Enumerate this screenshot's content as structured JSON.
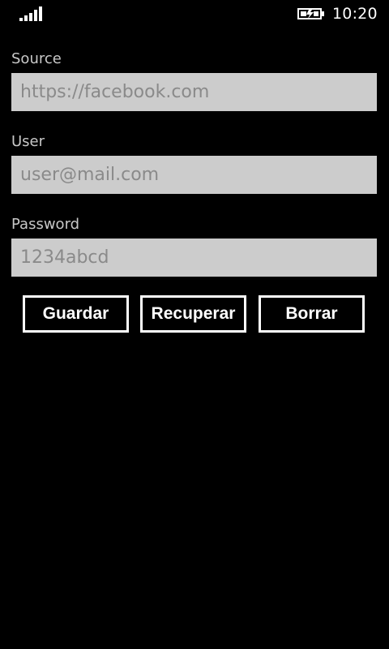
{
  "status_bar": {
    "time": "10:20",
    "signal_icon": "signal-strength-icon",
    "battery_icon": "battery-charging-icon"
  },
  "form": {
    "source": {
      "label": "Source",
      "placeholder": "https://facebook.com"
    },
    "user": {
      "label": "User",
      "placeholder": "user@mail.com"
    },
    "password": {
      "label": "Password",
      "placeholder": "1234abcd"
    }
  },
  "buttons": {
    "guardar": "Guardar",
    "recuperar": "Recuperar",
    "borrar": "Borrar"
  },
  "colors": {
    "background": "#000000",
    "input_background": "#cccccc",
    "placeholder": "#8a8a8a",
    "label": "#c8c8c8",
    "button_border": "#ffffff"
  }
}
